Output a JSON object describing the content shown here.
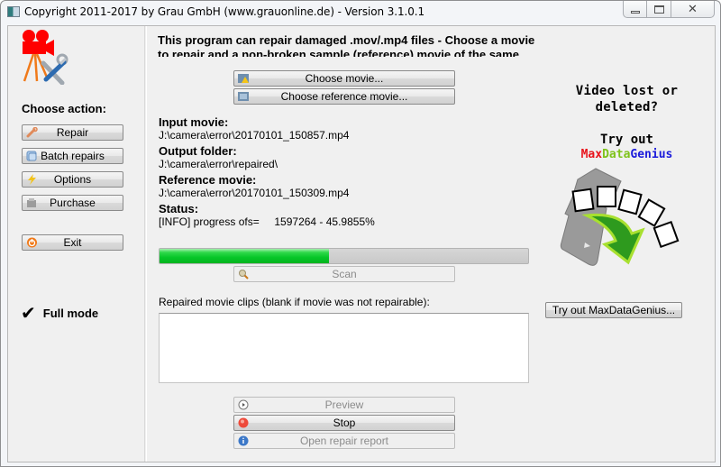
{
  "window": {
    "title": "Copyright 2011-2017 by Grau GmbH (www.grauonline.de) - Version 3.1.0.1",
    "controls": {
      "minimize": "minimize",
      "maximize": "maximize",
      "close": "✕"
    }
  },
  "sidebar": {
    "heading": "Choose action:",
    "buttons": [
      {
        "label": "Repair",
        "icon": "wrench-icon"
      },
      {
        "label": "Batch repairs",
        "icon": "batch-icon"
      },
      {
        "label": "Options",
        "icon": "lightning-icon"
      },
      {
        "label": "Purchase",
        "icon": "cart-icon"
      },
      {
        "label": "Exit",
        "icon": "power-icon"
      }
    ],
    "mode": {
      "check": "✔",
      "label": "Full mode"
    }
  },
  "main": {
    "intro": "This program can repair damaged .mov/.mp4 files - Choose a movie to repair and a non-broken sample (reference) movie of the same camera and same cam!",
    "choose_movie": "Choose movie...",
    "choose_reference": "Choose reference movie...",
    "input_movie": {
      "label": "Input movie:",
      "value": "J:\\camera\\error\\20170101_150857.mp4"
    },
    "output_folder": {
      "label": "Output folder:",
      "value": "J:\\camera\\error\\repaired\\"
    },
    "reference_movie": {
      "label": "Reference movie:",
      "value": "J:\\camera\\error\\20170101_150309.mp4"
    },
    "status": {
      "label": "Status:",
      "value": "[INFO] progress ofs=     1597264 - 45.9855%"
    },
    "progress_percent": 45.9855,
    "scan": "Scan",
    "clips_label": "Repaired movie clips (blank if movie was not repairable):",
    "clips": [],
    "preview": "Preview",
    "stop": "Stop",
    "open_report": "Open repair report"
  },
  "promo": {
    "question_line1": "Video lost or",
    "question_line2": "deleted?",
    "try_out": "Try out",
    "brand_parts": [
      {
        "text": "Max",
        "color": "#e8131b"
      },
      {
        "text": "Data",
        "color": "#7fc31c"
      },
      {
        "text": "Genius",
        "color": "#1a1adb"
      }
    ],
    "button": "Try out MaxDataGenius..."
  }
}
